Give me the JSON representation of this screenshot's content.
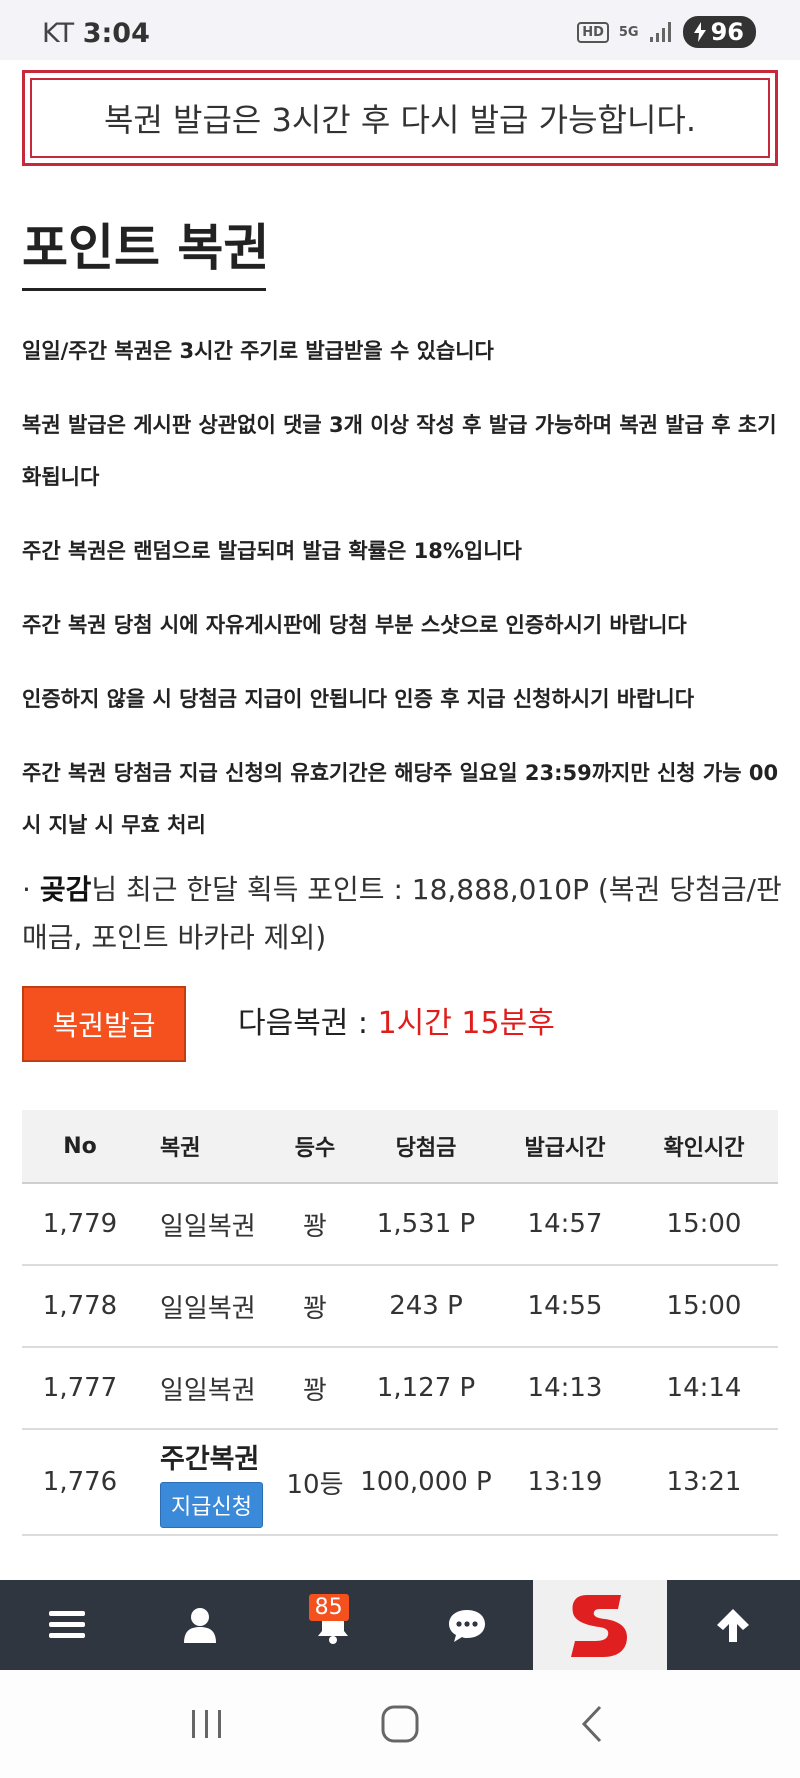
{
  "status": {
    "carrier": "KT",
    "time": "3:04",
    "hd": "HD",
    "network": "5G",
    "battery": "96"
  },
  "notice": "복권 발급은 3시간 후 다시 발급 가능합니다.",
  "title": "포인트 복권",
  "rules": [
    "일일/주간 복권은 3시간 주기로 발급받을 수 있습니다",
    "복권 발급은 게시판 상관없이 댓글 3개 이상 작성 후 발급 가능하며 복권 발급 후 초기화됩니다",
    "주간 복권은 랜덤으로 발급되며 발급 확률은 18%입니다",
    "주간 복권 당첨 시에 자유게시판에 당첨 부분 스샷으로 인증하시기 바랍니다",
    "인증하지 않을 시 당첨금 지급이 안됩니다 인증 후 지급 신청하시기 바랍니다",
    "주간 복권 당첨금 지급 신청의 유효기간은 해당주 일요일 23:59까지만 신청 가능 00시 지날 시 무효 처리"
  ],
  "points": {
    "bullet": "·",
    "user": "곶감",
    "text": "님 최근 한달 획득 포인트 : 18,888,010P (복권 당첨금/판매금, 포인트 바카라 제외)"
  },
  "issue_button": "복권발급",
  "next": {
    "label": "다음복권 : ",
    "time": "1시간 15분후"
  },
  "table": {
    "headers": [
      "No",
      "복권",
      "등수",
      "당첨금",
      "발급시간",
      "확인시간"
    ],
    "rows": [
      {
        "no": "1,779",
        "type": "일일복권",
        "rank": "꽝",
        "prize": "1,531 P",
        "issued": "14:57",
        "checked": "15:00"
      },
      {
        "no": "1,778",
        "type": "일일복권",
        "rank": "꽝",
        "prize": "243 P",
        "issued": "14:55",
        "checked": "15:00"
      },
      {
        "no": "1,777",
        "type": "일일복권",
        "rank": "꽝",
        "prize": "1,127 P",
        "issued": "14:13",
        "checked": "14:14"
      },
      {
        "no": "1,776",
        "type": "주간복권",
        "claim": "지급신청",
        "rank": "10등",
        "prize": "100,000 P",
        "issued": "13:19",
        "checked": "13:21"
      }
    ]
  },
  "nav": {
    "notification_count": "85",
    "items": [
      "menu-icon",
      "user-icon",
      "bell-icon",
      "chat-icon",
      "site-logo-icon",
      "arrow-up-icon"
    ]
  },
  "colors": {
    "accent": "#f4511e",
    "notice_border": "#c8283c",
    "next_time": "#e21b1b",
    "claim_button": "#3b8ad9",
    "nav_bg": "#2f3640"
  }
}
